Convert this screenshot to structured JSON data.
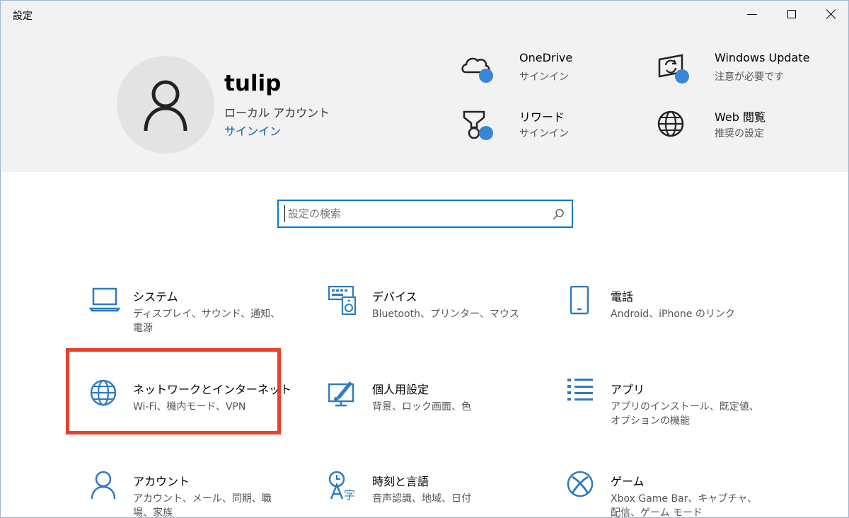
{
  "window": {
    "title": "設定",
    "minimize_label": "",
    "maximize_label": "",
    "close_label": ""
  },
  "user": {
    "name": "tulip",
    "account_type": "ローカル アカウント",
    "signin_link": "サインイン"
  },
  "header_items": [
    {
      "title": "OneDrive",
      "subtitle": "サインイン",
      "icon": "cloud-icon"
    },
    {
      "title": "Windows Update",
      "subtitle": "注意が必要です",
      "icon": "windows-update-icon"
    },
    {
      "title": "リワード",
      "subtitle": "サインイン",
      "icon": "trophy-icon"
    },
    {
      "title": "Web 閲覧",
      "subtitle": "推奨の設定",
      "icon": "globe-icon"
    }
  ],
  "search": {
    "placeholder": "設定の検索"
  },
  "categories": [
    {
      "title": "システム",
      "subtitle": "ディスプレイ、サウンド、通知、電源",
      "icon": "laptop-icon"
    },
    {
      "title": "デバイス",
      "subtitle": "Bluetooth、プリンター、マウス",
      "icon": "devices-icon"
    },
    {
      "title": "電話",
      "subtitle": "Android、iPhone のリンク",
      "icon": "phone-icon"
    },
    {
      "title": "ネットワークとインターネット",
      "subtitle": "Wi-Fi、機内モード、VPN",
      "icon": "globe-icon"
    },
    {
      "title": "個人用設定",
      "subtitle": "背景、ロック画面、色",
      "icon": "personalization-icon"
    },
    {
      "title": "アプリ",
      "subtitle": "アプリのインストール、既定値、オプションの機能",
      "icon": "apps-list-icon"
    },
    {
      "title": "アカウント",
      "subtitle": "アカウント、メール、同期、職場、家族",
      "icon": "person-icon"
    },
    {
      "title": "時刻と言語",
      "subtitle": "音声認識、地域、日付",
      "icon": "time-language-icon"
    },
    {
      "title": "ゲーム",
      "subtitle": "Xbox Game Bar、キャプチャ、配信、ゲーム モード",
      "icon": "xbox-icon"
    }
  ],
  "colors": {
    "accent": "#0078d7",
    "icon_blue": "#2f7ac0",
    "badge_blue": "#3a86d6",
    "highlight_red": "#e8402a",
    "header_bg": "#f2f2f2"
  }
}
